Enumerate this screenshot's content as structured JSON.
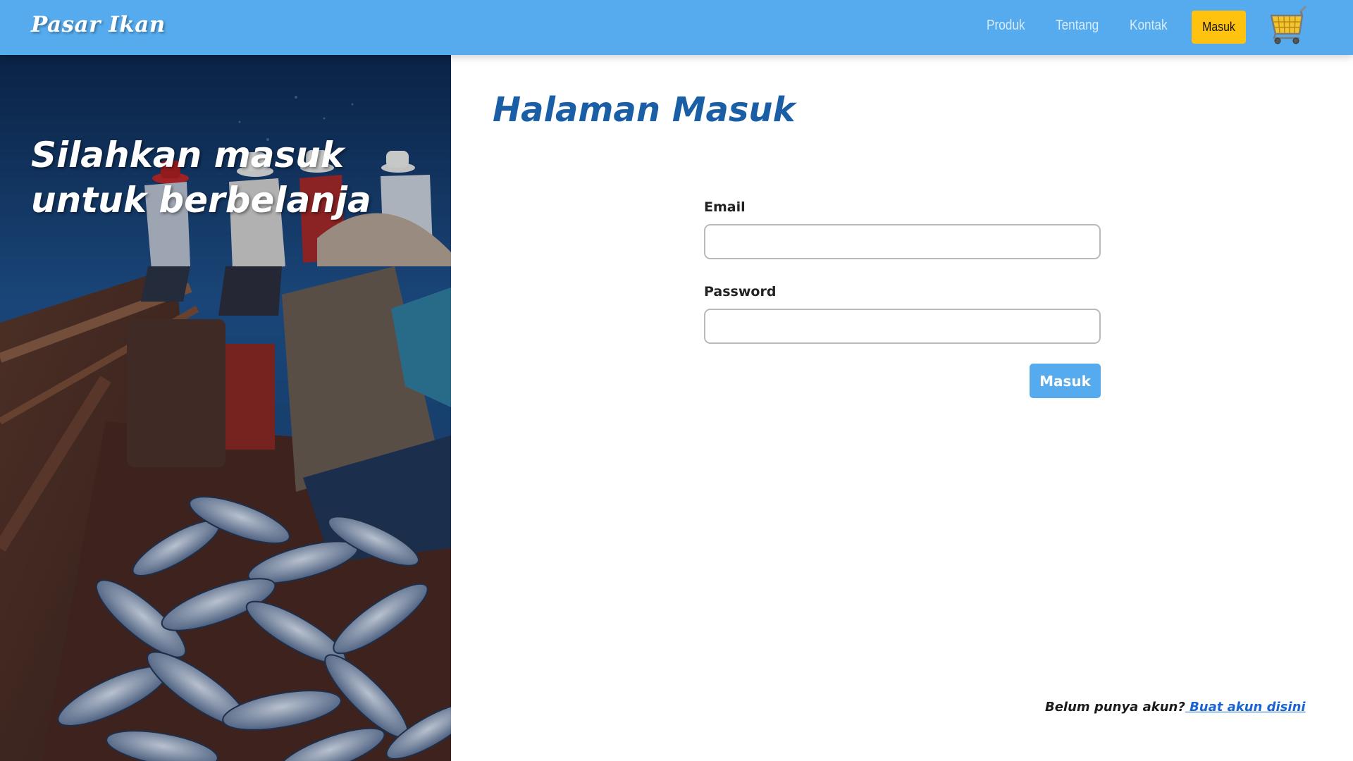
{
  "navbar": {
    "brand": "Pasar Ikan",
    "links": [
      "Produk",
      "Tentang",
      "Kontak"
    ],
    "login_button": "Masuk",
    "cart_icon": "shopping-cart-icon"
  },
  "hero": {
    "title": "Silahkan masuk untuk berbelanja",
    "image": "fishermen-boat-tuna-photo"
  },
  "form": {
    "title": "Halaman Masuk",
    "email_label": "Email",
    "email_value": "",
    "password_label": "Password",
    "password_value": "",
    "submit_label": "Masuk"
  },
  "register": {
    "prompt": "Belum punya akun?",
    "link_text": " Buat akun disini"
  },
  "colors": {
    "navbar": "#55abed",
    "login_button": "#ffc20e",
    "title": "#1a5fa6",
    "submit": "#55abed",
    "link": "#1a64d6"
  }
}
